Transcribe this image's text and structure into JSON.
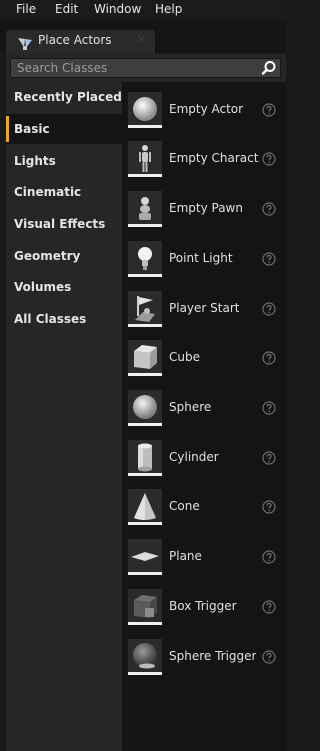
{
  "menu": [
    "File",
    "Edit",
    "Window",
    "Help"
  ],
  "tab": {
    "label": "Place Actors",
    "close": "×"
  },
  "search": {
    "placeholder": "Search Classes"
  },
  "categories": [
    "Recently Placed",
    "Basic",
    "Lights",
    "Cinematic",
    "Visual Effects",
    "Geometry",
    "Volumes",
    "All Classes"
  ],
  "selected_category": "Basic",
  "actors": [
    {
      "label": "Empty Actor",
      "icon": "sphere-icon"
    },
    {
      "label": "Empty Character",
      "icon": "mannequin-icon"
    },
    {
      "label": "Empty Pawn",
      "icon": "pawn-icon"
    },
    {
      "label": "Point Light",
      "icon": "light-bulb-icon"
    },
    {
      "label": "Player Start",
      "icon": "player-start-icon"
    },
    {
      "label": "Cube",
      "icon": "cube-icon"
    },
    {
      "label": "Sphere",
      "icon": "sphere-icon"
    },
    {
      "label": "Cylinder",
      "icon": "cylinder-icon"
    },
    {
      "label": "Cone",
      "icon": "cone-icon"
    },
    {
      "label": "Plane",
      "icon": "plane-icon"
    },
    {
      "label": "Box Trigger",
      "icon": "box-trigger-icon"
    },
    {
      "label": "Sphere Trigger",
      "icon": "sphere-trigger-icon"
    }
  ],
  "colors": {
    "accent": "#e8a825",
    "panel": "#262626",
    "list": "#141414"
  }
}
